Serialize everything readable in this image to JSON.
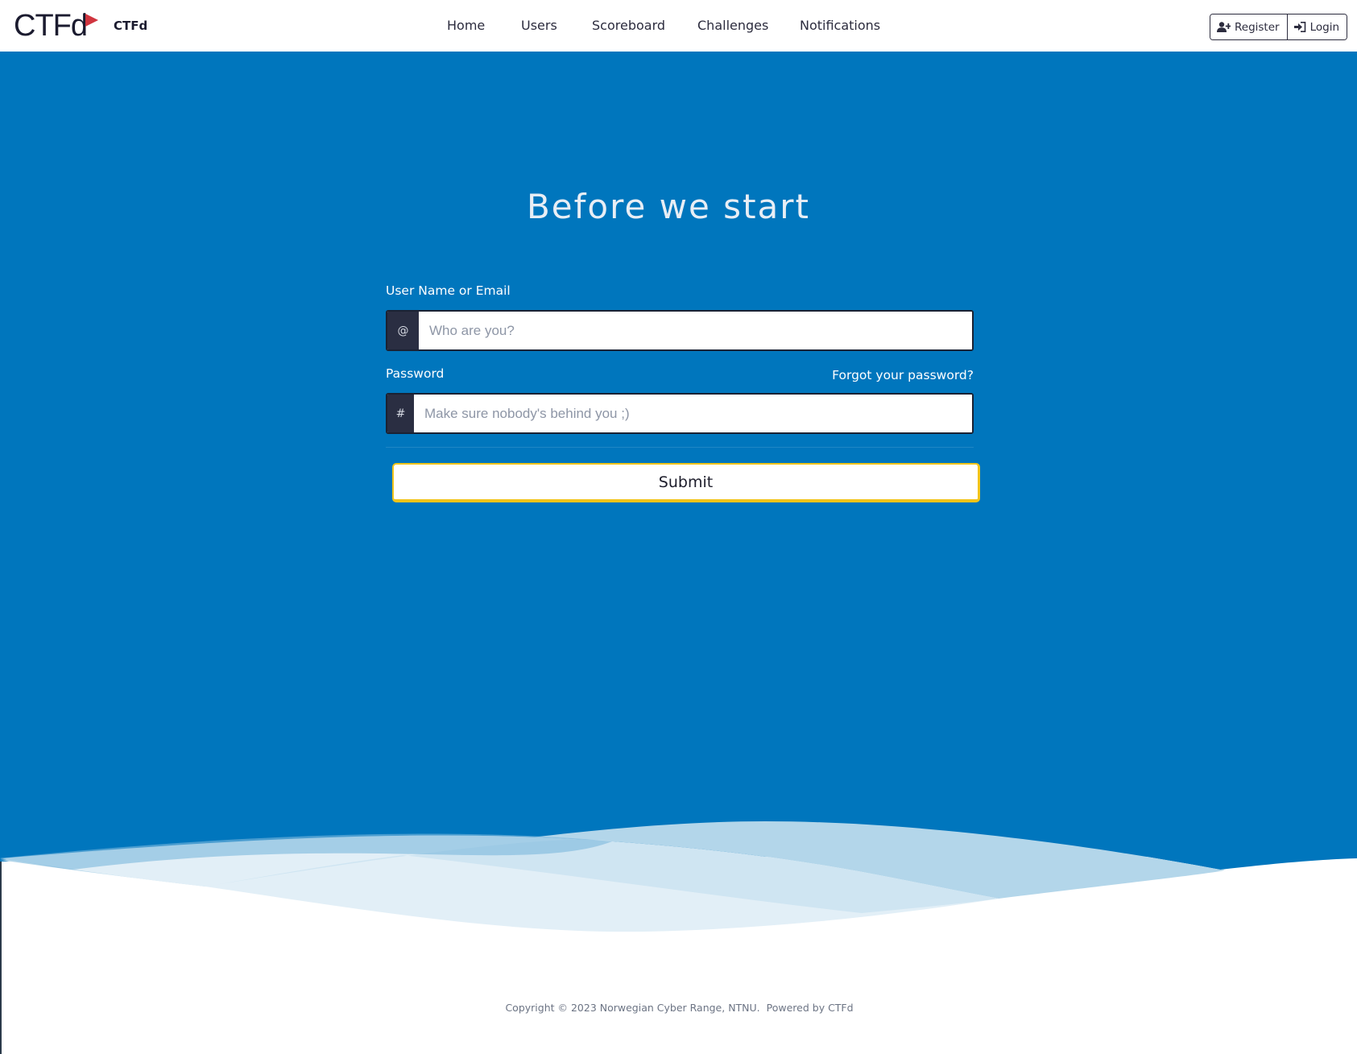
{
  "brand": {
    "logo_text": "CTFd",
    "name": "CTFd"
  },
  "nav": {
    "items": [
      {
        "label": "Home"
      },
      {
        "label": "Users"
      },
      {
        "label": "Scoreboard"
      },
      {
        "label": "Challenges"
      },
      {
        "label": "Notifications"
      }
    ],
    "register_label": "Register",
    "login_label": "Login"
  },
  "hero": {
    "title": "Before we start"
  },
  "login_form": {
    "username_label": "User Name or Email",
    "username_addon": "@",
    "username_placeholder": "Who are you?",
    "password_label": "Password",
    "forgot_link": "Forgot your password?",
    "password_addon": "#",
    "password_placeholder": "Make sure nobody's behind you ;)",
    "submit_label": "Submit"
  },
  "footer": {
    "copyright": "Copyright © 2023 Norwegian Cyber Range, NTNU.",
    "powered_by": "Powered by CTFd"
  },
  "colors": {
    "hero_background": "#0076bd",
    "submit_border": "#f2c41a",
    "addon_background": "#2a2e42",
    "logo_flag": "#d0353f"
  },
  "icons": {
    "register": "user-plus-icon",
    "login": "sign-in-icon",
    "logo_flag": "flag-icon"
  }
}
